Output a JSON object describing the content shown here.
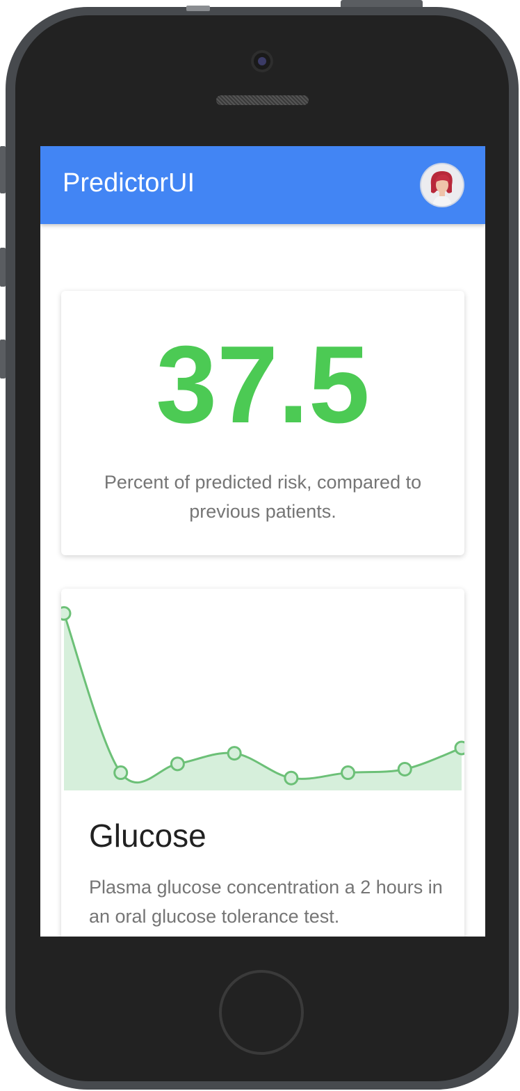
{
  "app_bar": {
    "title": "PredictorUI",
    "color": "#4285f4"
  },
  "user": {
    "avatar_icon": "user-avatar"
  },
  "risk": {
    "value": "37.5",
    "description": "Percent of predicted risk, compared to previous patients.",
    "color": "#4cca54"
  },
  "glucose": {
    "title": "Glucose",
    "description": "Plasma glucose concentration a 2 hours in an oral glucose tolerance test."
  },
  "chart_data": {
    "type": "area",
    "x": [
      0,
      1,
      2,
      3,
      4,
      5,
      6,
      7
    ],
    "values": [
      100,
      10,
      15,
      21,
      7,
      10,
      12,
      24
    ],
    "ylim": [
      0,
      114
    ],
    "grid": false,
    "line_color": "#6cc077",
    "fill_color": "#d6efdb"
  }
}
